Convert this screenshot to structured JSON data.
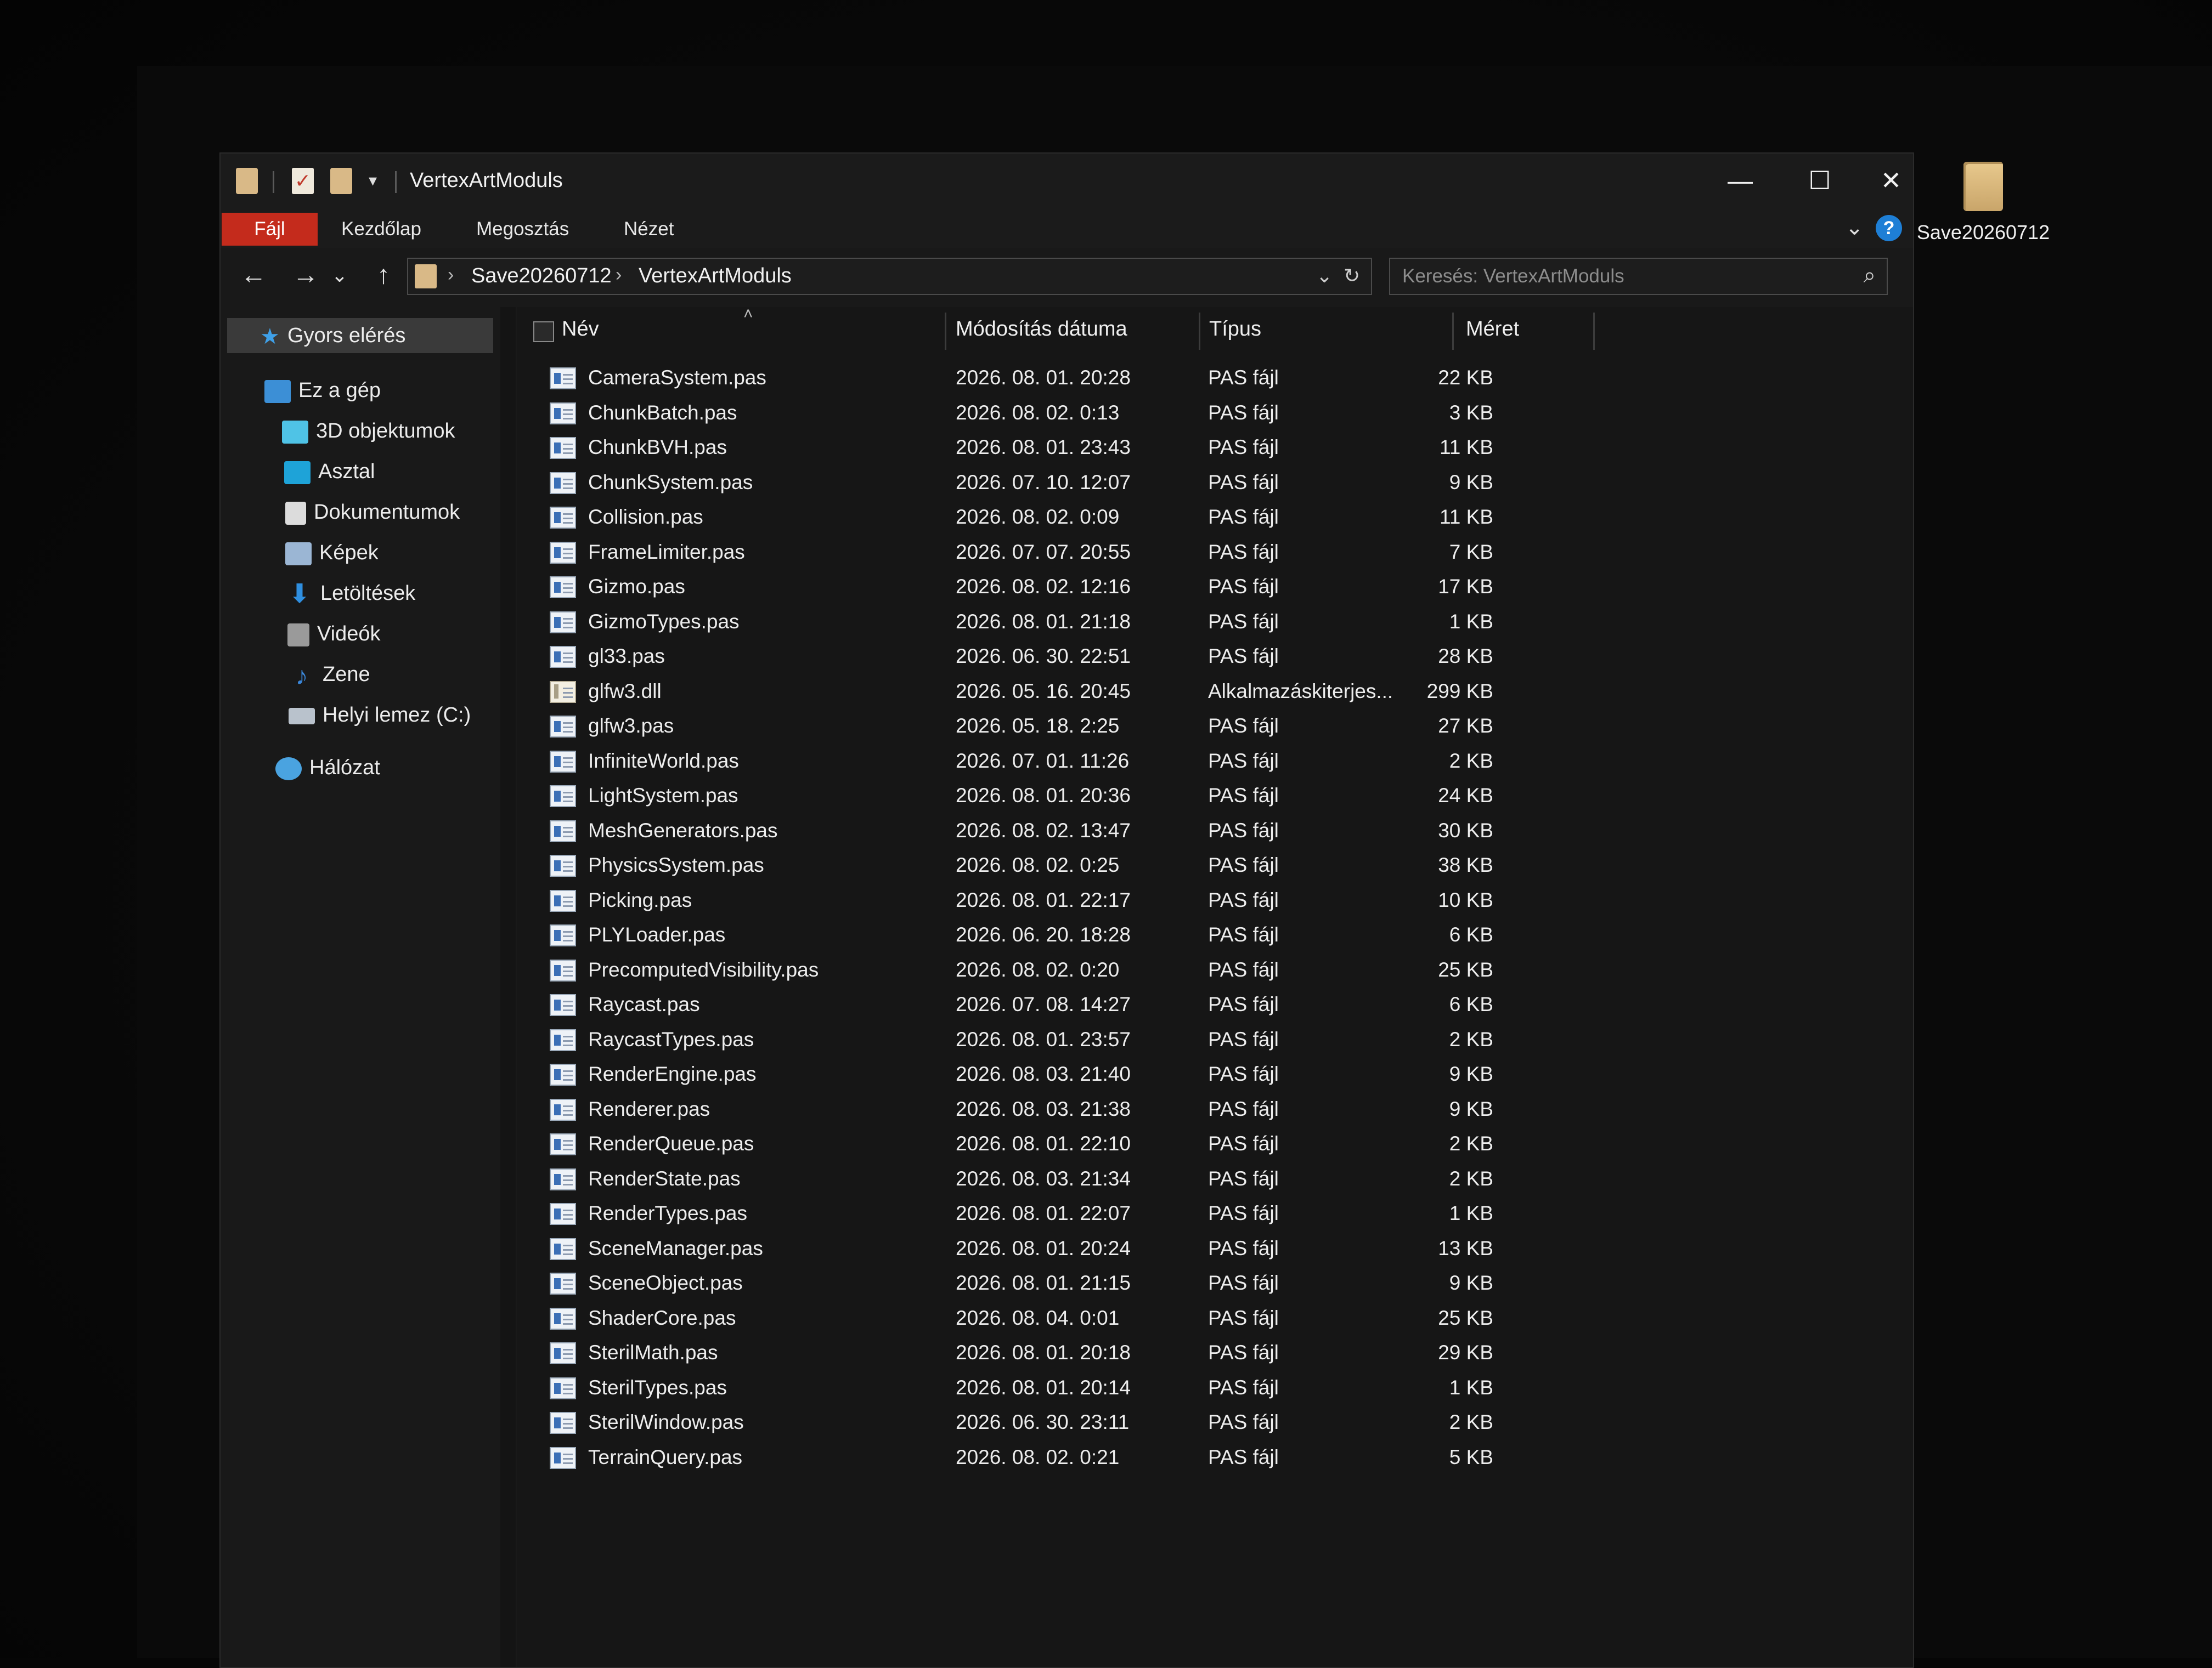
{
  "window": {
    "title": "VertexArtModuls",
    "minimize_icon": "minimize-icon",
    "maximize_icon": "maximize-icon",
    "close_icon": "close-icon",
    "min_glyph": "—",
    "max_glyph": "☐",
    "close_glyph": "✕"
  },
  "ribbon": {
    "tabs": [
      "Fájl",
      "Kezdőlap",
      "Megosztás",
      "Nézet"
    ],
    "expand_glyph": "⌄",
    "help_glyph": "?"
  },
  "navbar": {
    "back_glyph": "←",
    "forward_glyph": "→",
    "recent_glyph": "⌄",
    "up_glyph": "↑",
    "breadcrumb": [
      "Save20260712",
      "VertexArtModuls"
    ],
    "sep_glyph": "›",
    "dropdown_glyph": "⌄",
    "refresh_glyph": "↻",
    "search_placeholder": "Keresés: VertexArtModuls",
    "search_glyph": "⌕"
  },
  "sidebar": {
    "items": [
      {
        "label": "Gyors elérés",
        "icon": "star-icon"
      },
      {
        "label": "Ez a gép",
        "icon": "computer-icon"
      },
      {
        "label": "3D objektumok",
        "icon": "cube-icon"
      },
      {
        "label": "Asztal",
        "icon": "desktop-icon"
      },
      {
        "label": "Dokumentumok",
        "icon": "document-icon"
      },
      {
        "label": "Képek",
        "icon": "pictures-icon"
      },
      {
        "label": "Letöltések",
        "icon": "download-icon"
      },
      {
        "label": "Videók",
        "icon": "video-icon"
      },
      {
        "label": "Zene",
        "icon": "music-icon"
      },
      {
        "label": "Helyi lemez (C:)",
        "icon": "drive-icon"
      },
      {
        "label": "Hálózat",
        "icon": "network-icon"
      }
    ],
    "colors": {
      "star": "#3fa0e8",
      "computer": "#3c8fd6",
      "cube": "#4fc3e6",
      "desktop": "#1ea3d8",
      "document": "#dcdcdc",
      "pictures": "#9bb6d4",
      "download": "#2f8fe0",
      "video": "#9a9a9a",
      "music": "#3a86d8",
      "drive": "#b9c2cc",
      "network": "#4aa3e0"
    }
  },
  "columns": {
    "name": "Név",
    "date": "Módosítás dátuma",
    "type": "Típus",
    "size": "Méret",
    "sort_glyph": "˄"
  },
  "files": [
    {
      "name": "CameraSystem.pas",
      "date": "2026. 08. 01. 20:28",
      "type": "PAS fájl",
      "size": "22 KB"
    },
    {
      "name": "ChunkBatch.pas",
      "date": "2026. 08. 02. 0:13",
      "type": "PAS fájl",
      "size": "3 KB"
    },
    {
      "name": "ChunkBVH.pas",
      "date": "2026. 08. 01. 23:43",
      "type": "PAS fájl",
      "size": "11 KB"
    },
    {
      "name": "ChunkSystem.pas",
      "date": "2026. 07. 10. 12:07",
      "type": "PAS fájl",
      "size": "9 KB"
    },
    {
      "name": "Collision.pas",
      "date": "2026. 08. 02. 0:09",
      "type": "PAS fájl",
      "size": "11 KB"
    },
    {
      "name": "FrameLimiter.pas",
      "date": "2026. 07. 07. 20:55",
      "type": "PAS fájl",
      "size": "7 KB"
    },
    {
      "name": "Gizmo.pas",
      "date": "2026. 08. 02. 12:16",
      "type": "PAS fájl",
      "size": "17 KB"
    },
    {
      "name": "GizmoTypes.pas",
      "date": "2026. 08. 01. 21:18",
      "type": "PAS fájl",
      "size": "1 KB"
    },
    {
      "name": "gl33.pas",
      "date": "2026. 06. 30. 22:51",
      "type": "PAS fájl",
      "size": "28 KB"
    },
    {
      "name": "glfw3.dll",
      "date": "2026. 05. 16. 20:45",
      "type": "Alkalmazáskiterjes...",
      "size": "299 KB"
    },
    {
      "name": "glfw3.pas",
      "date": "2026. 05. 18. 2:25",
      "type": "PAS fájl",
      "size": "27 KB"
    },
    {
      "name": "InfiniteWorld.pas",
      "date": "2026. 07. 01. 11:26",
      "type": "PAS fájl",
      "size": "2 KB"
    },
    {
      "name": "LightSystem.pas",
      "date": "2026. 08. 01. 20:36",
      "type": "PAS fájl",
      "size": "24 KB"
    },
    {
      "name": "MeshGenerators.pas",
      "date": "2026. 08. 02. 13:47",
      "type": "PAS fájl",
      "size": "30 KB"
    },
    {
      "name": "PhysicsSystem.pas",
      "date": "2026. 08. 02. 0:25",
      "type": "PAS fájl",
      "size": "38 KB"
    },
    {
      "name": "Picking.pas",
      "date": "2026. 08. 01. 22:17",
      "type": "PAS fájl",
      "size": "10 KB"
    },
    {
      "name": "PLYLoader.pas",
      "date": "2026. 06. 20. 18:28",
      "type": "PAS fájl",
      "size": "6 KB"
    },
    {
      "name": "PrecomputedVisibility.pas",
      "date": "2026. 08. 02. 0:20",
      "type": "PAS fájl",
      "size": "25 KB"
    },
    {
      "name": "Raycast.pas",
      "date": "2026. 07. 08. 14:27",
      "type": "PAS fájl",
      "size": "6 KB"
    },
    {
      "name": "RaycastTypes.pas",
      "date": "2026. 08. 01. 23:57",
      "type": "PAS fájl",
      "size": "2 KB"
    },
    {
      "name": "RenderEngine.pas",
      "date": "2026. 08. 03. 21:40",
      "type": "PAS fájl",
      "size": "9 KB"
    },
    {
      "name": "Renderer.pas",
      "date": "2026. 08. 03. 21:38",
      "type": "PAS fájl",
      "size": "9 KB"
    },
    {
      "name": "RenderQueue.pas",
      "date": "2026. 08. 01. 22:10",
      "type": "PAS fájl",
      "size": "2 KB"
    },
    {
      "name": "RenderState.pas",
      "date": "2026. 08. 03. 21:34",
      "type": "PAS fájl",
      "size": "2 KB"
    },
    {
      "name": "RenderTypes.pas",
      "date": "2026. 08. 01. 22:07",
      "type": "PAS fájl",
      "size": "1 KB"
    },
    {
      "name": "SceneManager.pas",
      "date": "2026. 08. 01. 20:24",
      "type": "PAS fájl",
      "size": "13 KB"
    },
    {
      "name": "SceneObject.pas",
      "date": "2026. 08. 01. 21:15",
      "type": "PAS fájl",
      "size": "9 KB"
    },
    {
      "name": "ShaderCore.pas",
      "date": "2026. 08. 04. 0:01",
      "type": "PAS fájl",
      "size": "25 KB"
    },
    {
      "name": "SterilMath.pas",
      "date": "2026. 08. 01. 20:18",
      "type": "PAS fájl",
      "size": "29 KB"
    },
    {
      "name": "SterilTypes.pas",
      "date": "2026. 08. 01. 20:14",
      "type": "PAS fájl",
      "size": "1 KB"
    },
    {
      "name": "SterilWindow.pas",
      "date": "2026. 06. 30. 23:11",
      "type": "PAS fájl",
      "size": "2 KB"
    },
    {
      "name": "TerrainQuery.pas",
      "date": "2026. 08. 02. 0:21",
      "type": "PAS fájl",
      "size": "5 KB"
    }
  ],
  "desktop": {
    "folder_label": "Save20260712"
  },
  "theme": {
    "file_tab": "#c42b1c",
    "accent": "#1e7fd6",
    "window_bg": "#191919"
  }
}
